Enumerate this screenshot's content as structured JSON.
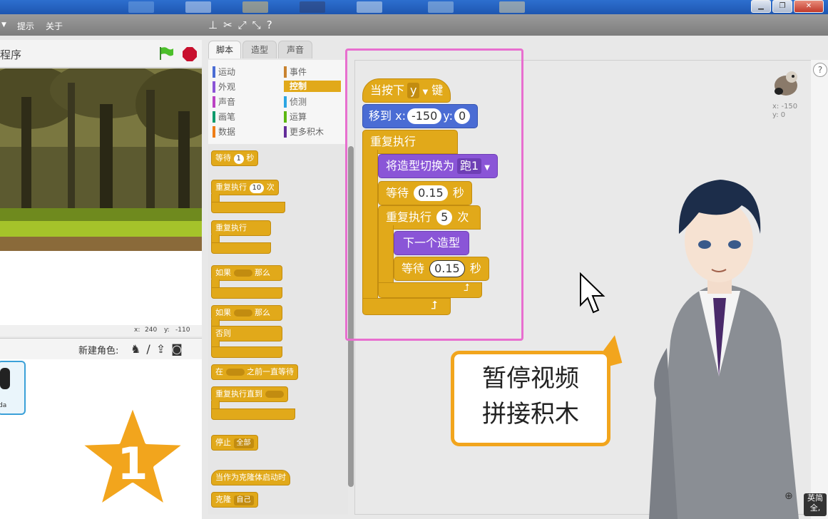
{
  "menu": {
    "tips": "提示",
    "about": "关于"
  },
  "stage": {
    "title": "程序",
    "mouse_x_label": "x:",
    "mouse_x": "240",
    "mouse_y_label": "y:",
    "mouse_y": "-110"
  },
  "sprites": {
    "new_sprite_label": "新建角色:",
    "thumb_label": "da"
  },
  "tabs": {
    "scripts": "脚本",
    "costumes": "造型",
    "sounds": "声音"
  },
  "categories": {
    "motion": "运动",
    "events": "事件",
    "looks": "外观",
    "control": "控制",
    "sound": "声音",
    "sensing": "侦测",
    "pen": "画笔",
    "operators": "运算",
    "data": "数据",
    "more": "更多积木"
  },
  "palette": {
    "wait": "等待",
    "wait_num": "1",
    "wait_unit": "秒",
    "repeat": "重复执行",
    "repeat_num": "10",
    "repeat_unit": "次",
    "forever": "重复执行",
    "if": "如果",
    "then": "那么",
    "if2": "如果",
    "then2": "那么",
    "else": "否则",
    "wait_until_pre": "在",
    "wait_until_post": "之前一直等待",
    "repeat_until": "重复执行直到",
    "stop": "停止",
    "stop_opt": "全部",
    "clone_start": "当作为克隆体启动时",
    "clone": "克隆",
    "clone_opt": "自己"
  },
  "script": {
    "hat_pre": "当按下",
    "hat_key": "y",
    "hat_post": "键",
    "goto": "移到",
    "goto_x_label": "x:",
    "goto_x": "-150",
    "goto_y_label": "y:",
    "goto_y": "0",
    "forever": "重复执行",
    "switch_costume": "将造型切换为",
    "costume": "跑1",
    "wait": "等待",
    "wait_val": "0.15",
    "wait_unit": "秒",
    "repeat": "重复执行",
    "repeat_val": "5",
    "repeat_unit": "次",
    "next_costume": "下一个造型",
    "wait2": "等待",
    "wait2_val": "0.15",
    "wait2_unit": "秒"
  },
  "sprite_info": {
    "x": "x: -150",
    "y": "y: 0"
  },
  "bubble": {
    "line1": "暂停视频",
    "line2": "拼接积木"
  },
  "star_number": "1",
  "ime": {
    "line1": "英简",
    "line2": "全,"
  },
  "colors": {
    "control": "#e1a91a",
    "motion": "#4a6cd4",
    "looks": "#8a55d7",
    "highlight": "#e86fcf",
    "bubble_border": "#f2a51d"
  }
}
